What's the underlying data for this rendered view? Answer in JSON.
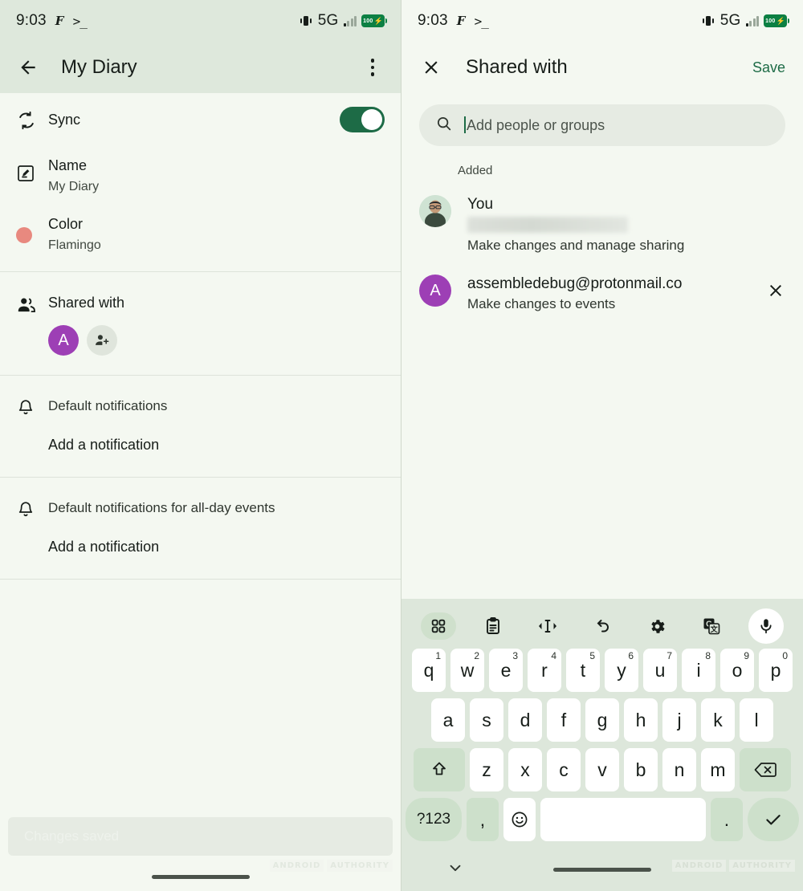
{
  "status_bar": {
    "time": "9:03",
    "icons": [
      "font-glyph-icon",
      "terminal-icon",
      "vibrate-icon"
    ],
    "network": "5G",
    "battery_percent": "100"
  },
  "left_screen": {
    "appbar": {
      "back_icon": "arrow-back-icon",
      "title": "My Diary",
      "overflow_icon": "kebab-menu-icon"
    },
    "settings": [
      {
        "id": "sync",
        "icon": "sync-icon",
        "label": "Sync",
        "toggle_on": true
      },
      {
        "id": "name",
        "icon": "edit-icon",
        "label": "Name",
        "value": "My Diary"
      },
      {
        "id": "color",
        "icon": "color-dot-icon",
        "label": "Color",
        "value": "Flamingo",
        "swatch": "#e8897f"
      },
      {
        "id": "shared-with",
        "icon": "people-icon",
        "label": "Shared with",
        "avatar_initial": "A",
        "avatar_color": "#9d3fb5",
        "add_icon": "person-add-icon"
      },
      {
        "id": "default-notifications",
        "icon": "bell-icon",
        "label": "Default notifications",
        "action": "Add a notification"
      },
      {
        "id": "default-notifications-allday",
        "icon": "bell-icon",
        "label": "Default notifications for all-day events",
        "action": "Add a notification"
      }
    ],
    "snackbar": "Changes saved",
    "watermark": [
      "ANDROID",
      "AUTHORITY"
    ]
  },
  "right_screen": {
    "appbar": {
      "close_icon": "close-icon",
      "title": "Shared with",
      "save_label": "Save"
    },
    "search": {
      "icon": "search-icon",
      "placeholder": "Add people or groups",
      "value": ""
    },
    "section_label": "Added",
    "people": [
      {
        "avatar_type": "photo",
        "name": "You",
        "email_redacted": true,
        "role": "Make changes and manage sharing",
        "removable": false
      },
      {
        "avatar_type": "letter",
        "avatar_initial": "A",
        "avatar_color": "#9d3fb5",
        "name": "assembledebug@protonmail.co",
        "role": "Make changes to events",
        "removable": true,
        "remove_icon": "close-icon"
      }
    ],
    "watermark": [
      "ANDROID",
      "AUTHORITY"
    ]
  },
  "keyboard": {
    "toolbar": [
      "apps-grid-icon",
      "clipboard-icon",
      "text-cursor-move-icon",
      "undo-icon",
      "settings-gear-icon",
      "translate-icon",
      "microphone-icon"
    ],
    "row1": [
      {
        "key": "q",
        "num": "1"
      },
      {
        "key": "w",
        "num": "2"
      },
      {
        "key": "e",
        "num": "3"
      },
      {
        "key": "r",
        "num": "4"
      },
      {
        "key": "t",
        "num": "5"
      },
      {
        "key": "y",
        "num": "6"
      },
      {
        "key": "u",
        "num": "7"
      },
      {
        "key": "i",
        "num": "8"
      },
      {
        "key": "o",
        "num": "9"
      },
      {
        "key": "p",
        "num": "0"
      }
    ],
    "row2": [
      "a",
      "s",
      "d",
      "f",
      "g",
      "h",
      "j",
      "k",
      "l"
    ],
    "row3": {
      "shift_icon": "shift-icon",
      "keys": [
        "z",
        "x",
        "c",
        "v",
        "b",
        "n",
        "m"
      ],
      "backspace_icon": "backspace-icon"
    },
    "row4": {
      "symbols_label": "?123",
      "comma": ",",
      "emoji_icon": "emoji-icon",
      "space": "",
      "period": ".",
      "enter_icon": "check-icon"
    },
    "dismiss_icon": "chevron-down-icon"
  },
  "colors": {
    "appbar_green": "#dee8dc",
    "surface": "#f4f8f1",
    "accent_green": "#1d6b46",
    "purple_avatar": "#9d3fb5",
    "flamingo": "#e8897f",
    "keyboard_bg": "#dde7db"
  }
}
